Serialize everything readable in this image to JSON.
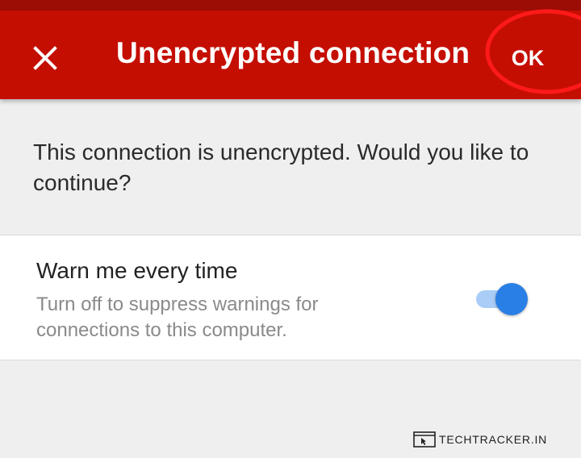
{
  "dialog": {
    "title": "Unencrypted connection",
    "close_icon": "close-icon",
    "ok_label": "OK",
    "message": "This connection is unencrypted. Would you like to continue?"
  },
  "setting": {
    "title": "Warn me every time",
    "subtitle": "Turn off to suppress warnings for connections to this computer.",
    "toggle_on": true
  },
  "annotation": {
    "highlight_color": "#ff1a1a"
  },
  "watermark": {
    "text": "TECHTRACKER.IN",
    "icon": "browser-cursor-icon"
  },
  "colors": {
    "appbar": "#c50e02",
    "statusbar": "#9c0d06",
    "toggle_thumb": "#2a7fe6",
    "toggle_track": "#a9cdf7",
    "background": "#efefef"
  }
}
